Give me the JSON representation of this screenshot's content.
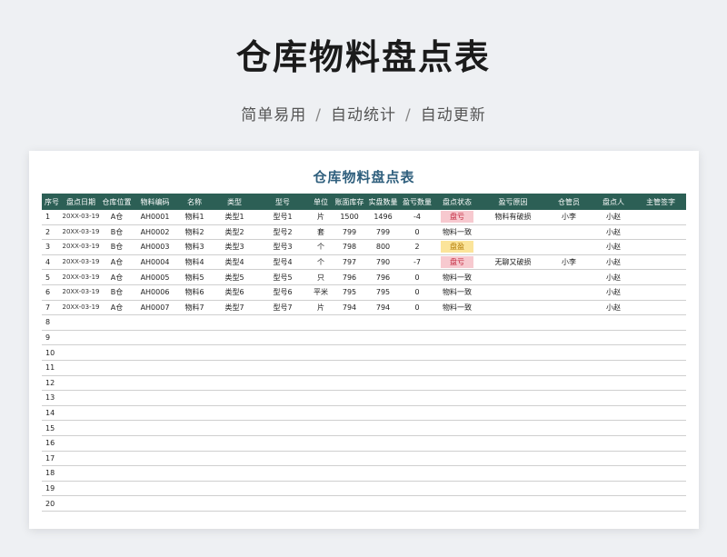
{
  "header": {
    "title": "仓库物料盘点表",
    "features": [
      "简单易用",
      "自动统计",
      "自动更新"
    ],
    "separator": "/"
  },
  "sheet": {
    "title": "仓库物料盘点表",
    "columns": [
      "序号",
      "盘点日期",
      "仓库位置",
      "物料编码",
      "名称",
      "类型",
      "型号",
      "单位",
      "账面库存",
      "实盘数量",
      "盈亏数量",
      "盘点状态",
      "盈亏原因",
      "仓管员",
      "盘点人",
      "主管签字"
    ],
    "rows": [
      {
        "no": "1",
        "date": "20XX-03-19",
        "location": "A仓",
        "code": "AH0001",
        "name": "物料1",
        "type": "类型1",
        "model": "型号1",
        "unit": "片",
        "book": "1500",
        "actual": "1496",
        "diff": "-4",
        "status": "盘亏",
        "reason": "物料有破损",
        "keeper": "小李",
        "checker": "小赵",
        "supervisor": ""
      },
      {
        "no": "2",
        "date": "20XX-03-19",
        "location": "B仓",
        "code": "AH0002",
        "name": "物料2",
        "type": "类型2",
        "model": "型号2",
        "unit": "套",
        "book": "799",
        "actual": "799",
        "diff": "0",
        "status": "物料一致",
        "reason": "",
        "keeper": "",
        "checker": "小赵",
        "supervisor": ""
      },
      {
        "no": "3",
        "date": "20XX-03-19",
        "location": "B仓",
        "code": "AH0003",
        "name": "物料3",
        "type": "类型3",
        "model": "型号3",
        "unit": "个",
        "book": "798",
        "actual": "800",
        "diff": "2",
        "status": "盘盈",
        "reason": "",
        "keeper": "",
        "checker": "小赵",
        "supervisor": ""
      },
      {
        "no": "4",
        "date": "20XX-03-19",
        "location": "A仓",
        "code": "AH0004",
        "name": "物料4",
        "type": "类型4",
        "model": "型号4",
        "unit": "个",
        "book": "797",
        "actual": "790",
        "diff": "-7",
        "status": "盘亏",
        "reason": "无聊又破损",
        "keeper": "小李",
        "checker": "小赵",
        "supervisor": ""
      },
      {
        "no": "5",
        "date": "20XX-03-19",
        "location": "A仓",
        "code": "AH0005",
        "name": "物料5",
        "type": "类型5",
        "model": "型号5",
        "unit": "只",
        "book": "796",
        "actual": "796",
        "diff": "0",
        "status": "物料一致",
        "reason": "",
        "keeper": "",
        "checker": "小赵",
        "supervisor": ""
      },
      {
        "no": "6",
        "date": "20XX-03-19",
        "location": "B仓",
        "code": "AH0006",
        "name": "物料6",
        "type": "类型6",
        "model": "型号6",
        "unit": "平米",
        "book": "795",
        "actual": "795",
        "diff": "0",
        "status": "物料一致",
        "reason": "",
        "keeper": "",
        "checker": "小赵",
        "supervisor": ""
      },
      {
        "no": "7",
        "date": "20XX-03-19",
        "location": "A仓",
        "code": "AH0007",
        "name": "物料7",
        "type": "类型7",
        "model": "型号7",
        "unit": "片",
        "book": "794",
        "actual": "794",
        "diff": "0",
        "status": "物料一致",
        "reason": "",
        "keeper": "",
        "checker": "小赵",
        "supervisor": ""
      }
    ],
    "empty_rows": [
      "8",
      "9",
      "10",
      "11",
      "12",
      "13",
      "14",
      "15",
      "16",
      "17",
      "18",
      "19",
      "20"
    ]
  },
  "status_colors": {
    "盘亏": "#f7c9cf",
    "盘盈": "#fbe49a"
  }
}
